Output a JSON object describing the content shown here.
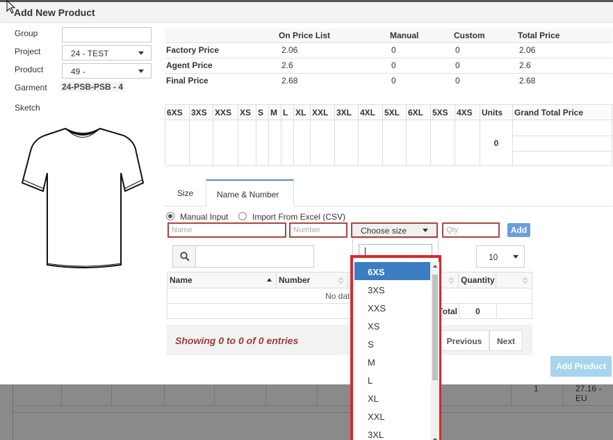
{
  "modal": {
    "title": "Add New Product"
  },
  "form": {
    "group_label": "Group",
    "group_value": "",
    "project_label": "Project",
    "project_value": "24 - TEST",
    "product_label": "Product",
    "product_value": "49 -",
    "garment_label": "Garment",
    "garment_value": "24-PSB-PSB - 4",
    "sketch_label": "Sketch"
  },
  "price_table": {
    "headers": [
      "",
      "On Price List",
      "Manual",
      "Custom",
      "Total Price"
    ],
    "rows": [
      {
        "name": "Factory Price",
        "on_price_list": "2.06",
        "manual": "0",
        "custom": "0",
        "total": "2.06"
      },
      {
        "name": "Agent Price",
        "on_price_list": "2.6",
        "manual": "0",
        "custom": "0",
        "total": "2.6"
      },
      {
        "name": "Final Price",
        "on_price_list": "2.68",
        "manual": "0",
        "custom": "0",
        "total": "2.68"
      }
    ]
  },
  "size_table": {
    "sizes": [
      "6XS",
      "3XS",
      "XXS",
      "XS",
      "S",
      "M",
      "L",
      "XL",
      "XXL",
      "3XL",
      "4XL",
      "5XL",
      "6XL",
      "5XS",
      "4XS"
    ],
    "units_header": "Units",
    "grand_total_header": "Grand Total Price",
    "units_value": "0"
  },
  "tabs": [
    {
      "label": "Size",
      "active": false
    },
    {
      "label": "Name & Number",
      "active": true
    }
  ],
  "input_mode": {
    "manual_label": "Manual Input",
    "manual_checked": true,
    "import_label": "Import From Excel (CSV)",
    "import_checked": false
  },
  "add_row": {
    "name_placeholder": "Name",
    "number_placeholder": "Number",
    "size_placeholder": "Choose size",
    "qty_placeholder": "Qty",
    "add_label": "Add"
  },
  "search": {
    "value": ""
  },
  "page_length": "10",
  "data_table": {
    "columns": [
      "Name",
      "Number",
      "",
      "Quantity",
      ""
    ],
    "empty_message": "No data avail",
    "total_label": "Total",
    "total_value": "0"
  },
  "pagination": {
    "info": "Showing 0 to 0 of 0 entries",
    "previous": "Previous",
    "next": "Next"
  },
  "add_product_label": "Add Product",
  "size_dropdown": {
    "search_value": "",
    "options": [
      "6XS",
      "3XS",
      "XXS",
      "XS",
      "S",
      "M",
      "L",
      "XL",
      "XXL",
      "3XL"
    ],
    "selected": "6XS"
  },
  "background_page": {
    "cell_value": "1",
    "cell_price": "27.16 - EU"
  },
  "colors": {
    "accent": "#3c7dc2",
    "error_border": "#a94442",
    "highlight_border": "#d9282f",
    "add_product_bg": "#a8d4ee"
  }
}
